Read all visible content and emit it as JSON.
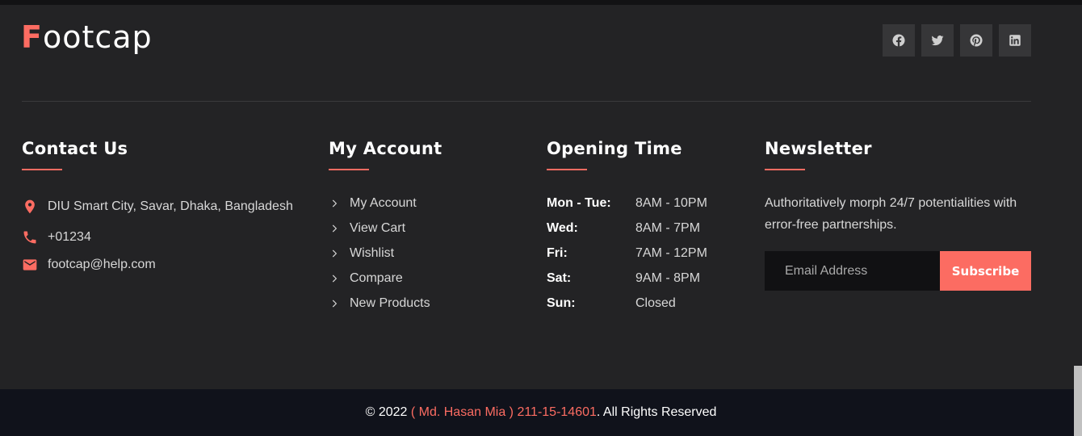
{
  "brand": {
    "first_letter": "F",
    "rest": "ootcap"
  },
  "social": [
    {
      "icon": "facebook-icon"
    },
    {
      "icon": "twitter-icon"
    },
    {
      "icon": "pinterest-icon"
    },
    {
      "icon": "linkedin-icon"
    }
  ],
  "contact": {
    "title": "Contact Us",
    "address": "DIU Smart City, Savar, Dhaka, Bangladesh",
    "phone": "+01234",
    "email": "footcap@help.com"
  },
  "account": {
    "title": "My Account",
    "links": [
      "My Account",
      "View Cart",
      "Wishlist",
      "Compare",
      "New Products"
    ]
  },
  "opening": {
    "title": "Opening Time",
    "hours": [
      {
        "day": "Mon - Tue:",
        "time": "8AM - 10PM"
      },
      {
        "day": "Wed:",
        "time": "8AM - 7PM"
      },
      {
        "day": "Fri:",
        "time": "7AM - 12PM"
      },
      {
        "day": "Sat:",
        "time": "9AM - 8PM"
      },
      {
        "day": "Sun:",
        "time": "Closed"
      }
    ]
  },
  "newsletter": {
    "title": "Newsletter",
    "text": "Authoritatively morph 24/7 potentialities with error-free partnerships.",
    "placeholder": "Email Address",
    "button": "Subscribe"
  },
  "footer": {
    "prefix": "© 2022 ",
    "author": "( Md. Hasan Mia ) 211-15-14601",
    "suffix": ". All Rights Reserved"
  },
  "colors": {
    "accent": "#fc6c62",
    "background": "#232325",
    "bottom_bar": "#10121b"
  }
}
